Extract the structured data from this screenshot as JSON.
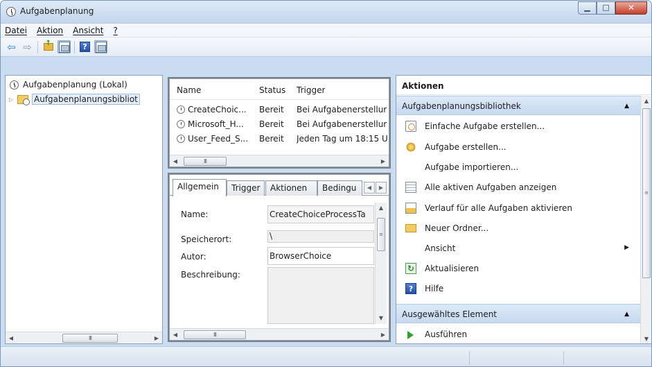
{
  "window": {
    "title": "Aufgabenplanung"
  },
  "menu": [
    {
      "label": "Datei"
    },
    {
      "label": "Aktion"
    },
    {
      "label": "Ansicht"
    },
    {
      "label": "?"
    }
  ],
  "tree": {
    "root_label": "Aufgabenplanung (Lokal)",
    "child_label": "Aufgabenplanungsbibliot",
    "scroll_thumb": "III"
  },
  "task_list": {
    "columns": [
      "Name",
      "Status",
      "Trigger"
    ],
    "rows": [
      {
        "name": "CreateChoic...",
        "status": "Bereit",
        "trigger": "Bei Aufgabenerstellur"
      },
      {
        "name": "Microsoft_H...",
        "status": "Bereit",
        "trigger": "Bei Aufgabenerstellur"
      },
      {
        "name": "User_Feed_S...",
        "status": "Bereit",
        "trigger": "Jeden Tag um 18:15 U"
      }
    ],
    "scroll_thumb": "III"
  },
  "detail": {
    "tabs": [
      "Allgemein",
      "Trigger",
      "Aktionen",
      "Bedingu"
    ],
    "fields": {
      "name_label": "Name:",
      "name_value": "CreateChoiceProcessTa",
      "location_label": "Speicherort:",
      "location_value": "\\",
      "author_label": "Autor:",
      "author_value": "BrowserChoice",
      "description_label": "Beschreibung:"
    },
    "scroll_thumb": "III"
  },
  "actions": {
    "title": "Aktionen",
    "section1": {
      "label": "Aufgabenplanungsbibliothek",
      "items": [
        {
          "label": "Einfache Aufgabe erstellen...",
          "icon": "basic-task-icon"
        },
        {
          "label": "Aufgabe erstellen...",
          "icon": "create-task-icon"
        },
        {
          "label": "Aufgabe importieren...",
          "icon": ""
        },
        {
          "label": "Alle aktiven Aufgaben anzeigen",
          "icon": "active-tasks-icon"
        },
        {
          "label": "Verlauf für alle Aufgaben aktivieren",
          "icon": "history-icon"
        },
        {
          "label": "Neuer Ordner...",
          "icon": "folder-icon"
        },
        {
          "label": "Ansicht",
          "icon": ""
        },
        {
          "label": "Aktualisieren",
          "icon": "refresh-icon"
        },
        {
          "label": "Hilfe",
          "icon": "help-icon"
        }
      ]
    },
    "section2": {
      "label": "Ausgewähltes Element",
      "items": [
        {
          "label": "Ausführen",
          "icon": "run-icon"
        }
      ]
    }
  },
  "colors": {
    "window_frame": "#c9dcf2",
    "section_header": "#c6d9f0",
    "close_button": "#c2402c"
  }
}
